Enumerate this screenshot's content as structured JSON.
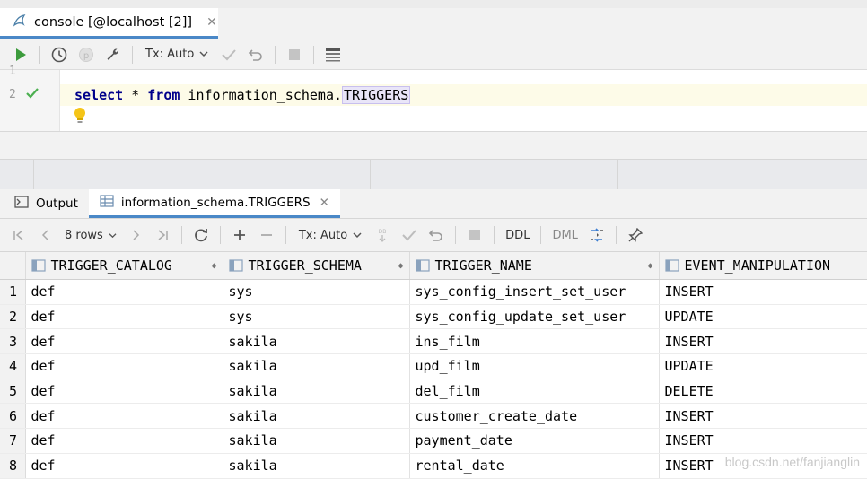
{
  "window": {
    "tab_title": "console [@localhost [2]]"
  },
  "toolbar1": {
    "tx_mode": "Tx: Auto",
    "icons": [
      "run-icon",
      "history-icon",
      "parameters-icon",
      "settings-wrench-icon",
      "commit-icon",
      "rollback-icon",
      "stop-icon",
      "results-layout-icon"
    ]
  },
  "editor": {
    "line_numbers": [
      "1",
      "2"
    ],
    "code": {
      "kw1": "select",
      "mid1": " * ",
      "kw2": "from",
      "mid2": " information_schema.",
      "table": "TRIGGERS"
    }
  },
  "output": {
    "tabs": [
      {
        "label": "Output",
        "active": false
      },
      {
        "label": "information_schema.TRIGGERS",
        "active": true
      }
    ]
  },
  "toolbar2": {
    "rows_label": "8 rows",
    "tx_mode": "Tx: Auto",
    "ddl": "DDL",
    "dml": "DML"
  },
  "grid": {
    "columns": [
      "TRIGGER_CATALOG",
      "TRIGGER_SCHEMA",
      "TRIGGER_NAME",
      "EVENT_MANIPULATION"
    ],
    "rows": [
      {
        "n": "1",
        "cells": [
          "def",
          "sys",
          "sys_config_insert_set_user",
          "INSERT"
        ]
      },
      {
        "n": "2",
        "cells": [
          "def",
          "sys",
          "sys_config_update_set_user",
          "UPDATE"
        ]
      },
      {
        "n": "3",
        "cells": [
          "def",
          "sakila",
          "ins_film",
          "INSERT"
        ]
      },
      {
        "n": "4",
        "cells": [
          "def",
          "sakila",
          "upd_film",
          "UPDATE"
        ]
      },
      {
        "n": "5",
        "cells": [
          "def",
          "sakila",
          "del_film",
          "DELETE"
        ]
      },
      {
        "n": "6",
        "cells": [
          "def",
          "sakila",
          "customer_create_date",
          "INSERT"
        ]
      },
      {
        "n": "7",
        "cells": [
          "def",
          "sakila",
          "payment_date",
          "INSERT"
        ]
      },
      {
        "n": "8",
        "cells": [
          "def",
          "sakila",
          "rental_date",
          "INSERT"
        ]
      }
    ]
  },
  "watermark": "blog.csdn.net/fanjianglin",
  "colors": {
    "accent": "#4a88c7",
    "run_green": "#3c9b3c",
    "keyword": "#00008b"
  }
}
